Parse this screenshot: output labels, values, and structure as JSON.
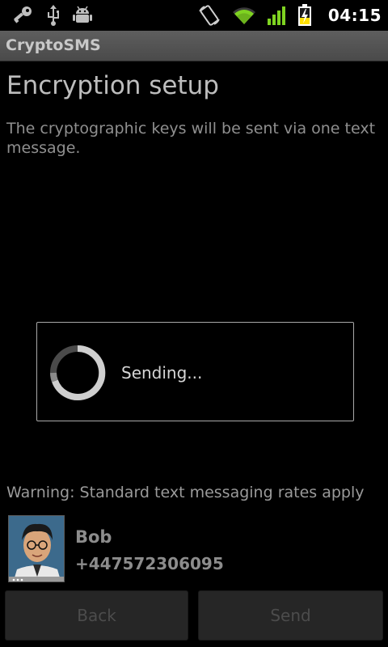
{
  "status_bar": {
    "time": "04:15",
    "icons": [
      "key-icon",
      "usb-icon",
      "android-debug-icon",
      "auto-rotate-icon",
      "wifi-icon",
      "signal-icon",
      "battery-charging-icon"
    ]
  },
  "app": {
    "title": "CryptoSMS"
  },
  "page": {
    "heading": "Encryption setup",
    "description": "The cryptographic keys will be sent via one text message."
  },
  "dialog": {
    "message": "Sending..."
  },
  "warning": "Warning: Standard text messaging rates apply",
  "contact": {
    "name": "Bob",
    "phone": "+447572306095"
  },
  "buttons": {
    "back_label": "Back",
    "send_label": "Send"
  },
  "colors": {
    "wifi_signal_green": "#7fd321",
    "battery_yellow": "#ffe000",
    "title_bar": "#555555"
  }
}
